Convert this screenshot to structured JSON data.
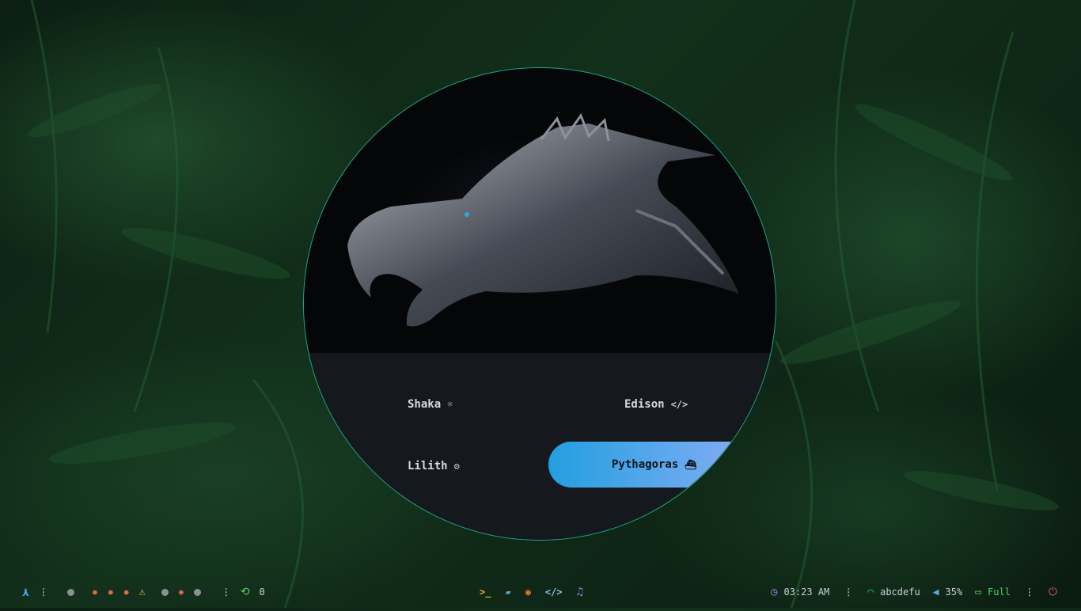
{
  "menu": {
    "items": [
      {
        "label": "Shaka",
        "icon": "bug-icon",
        "glyph": "☼"
      },
      {
        "label": "Edison",
        "icon": "code-icon",
        "glyph": "</>"
      },
      {
        "label": "Lilith",
        "icon": "gear-icon",
        "glyph": "⚙"
      },
      {
        "label": "Pythagoras",
        "icon": "ship-icon",
        "glyph": "⛴",
        "selected": true
      }
    ]
  },
  "bar": {
    "left": {
      "launcher_glyph": "⋏",
      "separator": "⋮",
      "workspaces": [
        "dot",
        "bug",
        "bug",
        "bug",
        "bug-active",
        "dot",
        "bug",
        "dot"
      ],
      "updates_count": "0"
    },
    "center": {
      "apps": [
        {
          "name": "terminal-icon",
          "glyph": ">_",
          "color": "#e8b030"
        },
        {
          "name": "folder-icon",
          "glyph": "▰",
          "color": "#5aa2d8"
        },
        {
          "name": "firefox-icon",
          "glyph": "◉",
          "color": "#f07a2a"
        },
        {
          "name": "code-editor-icon",
          "glyph": "</>",
          "color": "#8fbfe8"
        },
        {
          "name": "music-icon",
          "glyph": "♫",
          "color": "#9a7ae8"
        }
      ]
    },
    "right": {
      "time": "03:23 AM",
      "wifi_name": "abcdefu",
      "volume": "35%",
      "battery": "Full",
      "colors": {
        "clock": "#9b7ee8",
        "wifi": "#2fc7a0",
        "volume": "#5aa8e8",
        "battery": "#56d364",
        "power": "#e04a7a"
      }
    }
  }
}
